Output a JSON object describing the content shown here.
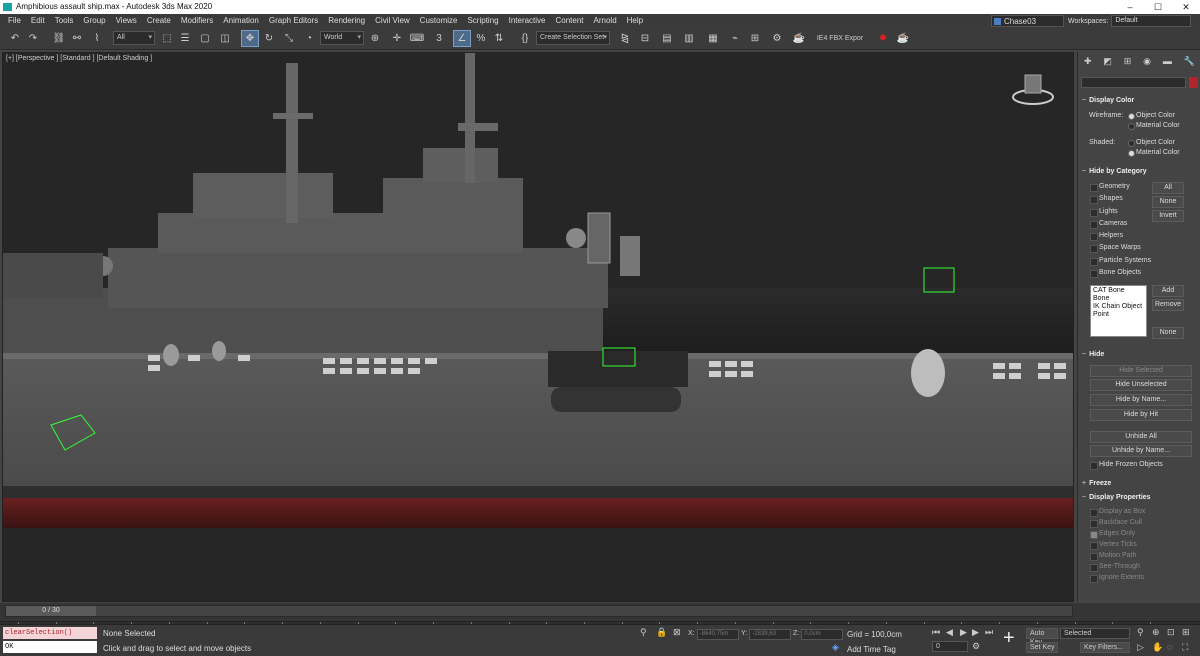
{
  "window": {
    "title": "Amphibious assault ship.max - Autodesk 3ds Max 2020"
  },
  "menu": [
    "File",
    "Edit",
    "Tools",
    "Group",
    "Views",
    "Create",
    "Modifiers",
    "Animation",
    "Graph Editors",
    "Rendering",
    "Civil View",
    "Customize",
    "Scripting",
    "Interactive",
    "Content",
    "Arnold",
    "Help"
  ],
  "user": {
    "name": "Chase03"
  },
  "workspace": {
    "label": "Workspaces:",
    "value": "Default"
  },
  "toolbar": {
    "filter": "All",
    "coord_system": "World",
    "selection_set": "Create Selection Set",
    "export_label": "IE4 FBX Expor"
  },
  "viewport": {
    "label": "[+] [Perspective ] [Standard ] [Default Shading ]"
  },
  "cmd_panel": {
    "display_color": {
      "title": "Display Color",
      "wireframe_label": "Wireframe:",
      "shaded_label": "Shaded:",
      "object_color": "Object Color",
      "material_color": "Material Color"
    },
    "hide_by_category": {
      "title": "Hide by Category",
      "items": [
        "Geometry",
        "Shapes",
        "Lights",
        "Cameras",
        "Helpers",
        "Space Warps",
        "Particle Systems",
        "Bone Objects"
      ],
      "all": "All",
      "none": "None",
      "invert": "Invert",
      "list": [
        "CAT Bone",
        "Bone",
        "IK Chain Object",
        "Point"
      ],
      "add": "Add",
      "remove": "Remove",
      "none2": "None"
    },
    "hide": {
      "title": "Hide",
      "hide_selected": "Hide Selected",
      "hide_unselected": "Hide Unselected",
      "hide_by_name": "Hide by Name...",
      "hide_by_hit": "Hide by Hit",
      "unhide_all": "Unhide All",
      "unhide_by_name": "Unhide by Name...",
      "hide_frozen": "Hide Frozen Objects"
    },
    "freeze": {
      "title": "Freeze"
    },
    "display_properties": {
      "title": "Display Properties",
      "items": [
        "Display as Box",
        "Backface Cull",
        "Edges Only",
        "Vertex Ticks",
        "Motion Path",
        "See-Through",
        "Ignore Extents"
      ]
    }
  },
  "timeline": {
    "position": "0 / 30",
    "ticks": [
      "0",
      "1",
      "2",
      "3",
      "4",
      "5",
      "6",
      "7",
      "8",
      "9",
      "10",
      "11",
      "12",
      "13",
      "14",
      "15",
      "16",
      "17",
      "18",
      "19",
      "20",
      "21",
      "22",
      "23",
      "24",
      "25",
      "26",
      "27",
      "28",
      "29",
      "30"
    ]
  },
  "status": {
    "maxscript_input": "clearSelection()",
    "maxscript_output": "OK",
    "selected": "None Selected",
    "prompt": "Click and drag to select and move objects",
    "x_label": "X:",
    "x_val": "-8640,75m",
    "y_label": "Y:",
    "y_val": "-2839,63",
    "z_label": "Z:",
    "z_val": "0,0cm",
    "grid": "Grid = 100,0cm",
    "add_time_tag": "Add Time Tag",
    "auto_key": "Auto Key",
    "set_key": "Set Key",
    "selected_dd": "Selected",
    "key_filters": "Key Filters...",
    "frame": "0"
  }
}
